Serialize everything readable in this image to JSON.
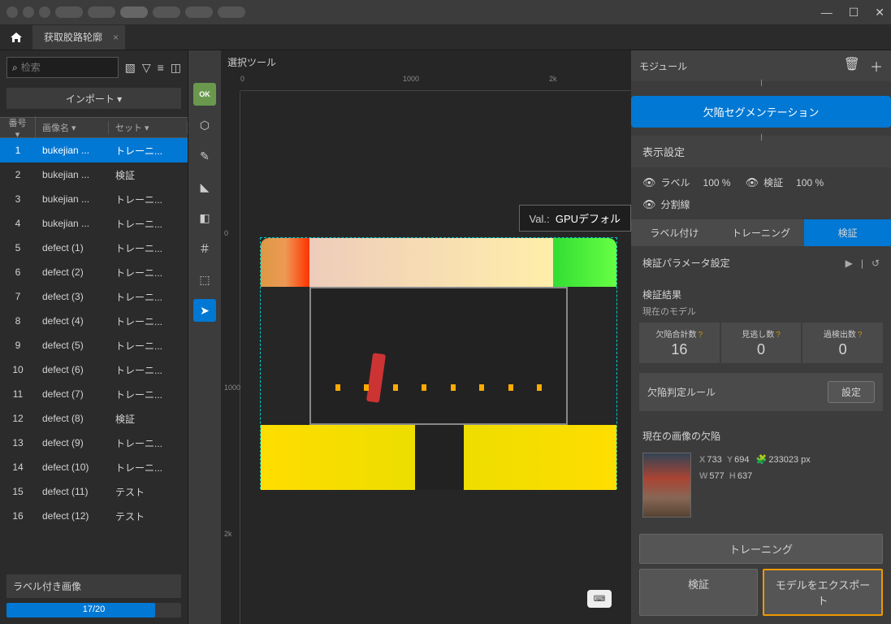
{
  "window": {
    "tab_title": "获取胶路轮廓"
  },
  "sidebar": {
    "search_placeholder": "检索",
    "import": "インポート  ▾",
    "headers": {
      "num": "番号 ▾",
      "name": "画像名 ▾",
      "set": "セット ▾"
    },
    "rows": [
      {
        "n": "1",
        "name": "bukejian ...",
        "set": "トレーニ..."
      },
      {
        "n": "2",
        "name": "bukejian ...",
        "set": "検証"
      },
      {
        "n": "3",
        "name": "bukejian ...",
        "set": "トレーニ..."
      },
      {
        "n": "4",
        "name": "bukejian ...",
        "set": "トレーニ..."
      },
      {
        "n": "5",
        "name": "defect (1)",
        "set": "トレーニ..."
      },
      {
        "n": "6",
        "name": "defect (2)",
        "set": "トレーニ..."
      },
      {
        "n": "7",
        "name": "defect (3)",
        "set": "トレーニ..."
      },
      {
        "n": "8",
        "name": "defect (4)",
        "set": "トレーニ..."
      },
      {
        "n": "9",
        "name": "defect (5)",
        "set": "トレーニ..."
      },
      {
        "n": "10",
        "name": "defect (6)",
        "set": "トレーニ..."
      },
      {
        "n": "11",
        "name": "defect (7)",
        "set": "トレーニ..."
      },
      {
        "n": "12",
        "name": "defect (8)",
        "set": "検証"
      },
      {
        "n": "13",
        "name": "defect (9)",
        "set": "トレーニ..."
      },
      {
        "n": "14",
        "name": "defect (10)",
        "set": "トレーニ..."
      },
      {
        "n": "15",
        "name": "defect (11)",
        "set": "テスト"
      },
      {
        "n": "16",
        "name": "defect (12)",
        "set": "テスト"
      }
    ],
    "footer_label": "ラベル付き画像",
    "progress": "17/20"
  },
  "tools": {
    "ok": "OK"
  },
  "canvas": {
    "label": "選択ツール",
    "ruler_h": [
      "0",
      "1000",
      "2k"
    ],
    "ruler_v": [
      "0",
      "1000",
      "2k"
    ],
    "val_prefix": "Val.:",
    "val_text": "GPUデフォル"
  },
  "right": {
    "header": "モジュール",
    "seg_btn": "欠陥セグメンテーション",
    "display_title": "表示設定",
    "vis": {
      "label": "ラベル",
      "label_pct": "100 %",
      "verify": "検証",
      "verify_pct": "100 %",
      "split": "分割線"
    },
    "tabs": {
      "labeling": "ラベル付け",
      "training": "トレーニング",
      "verify": "検証"
    },
    "param": "検証パラメータ設定",
    "result_title": "検証結果",
    "result_sub": "現在のモデル",
    "stats": {
      "total_label": "欠陥合計数",
      "total": "16",
      "miss_label": "見逃し数",
      "miss": "0",
      "over_label": "過検出数",
      "over": "0"
    },
    "rule": "欠陥判定ルール",
    "rule_btn": "設定",
    "defect_title": "現在の画像の欠陥",
    "defect": {
      "x": "733",
      "y": "694",
      "area": "233023 px",
      "w": "577",
      "h": "637"
    },
    "footer": {
      "train": "トレーニング",
      "verify": "検証",
      "export": "モデルをエクスポート"
    }
  }
}
